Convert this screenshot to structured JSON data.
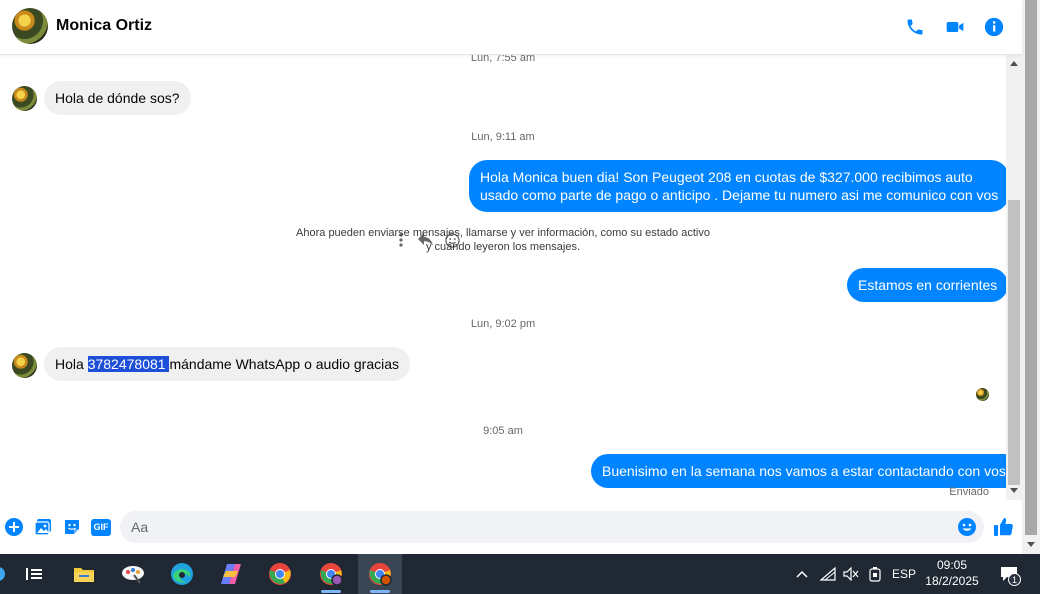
{
  "header": {
    "contact_name": "Monica Ortiz",
    "icons": [
      "phone-icon",
      "video-icon",
      "info-icon"
    ],
    "accent_color": "#0084ff"
  },
  "conversation": {
    "ts1": "Lun, 7:55 am",
    "msg1": "Hola de dónde sos?",
    "ts2": "Lun, 9:11 am",
    "msg2_line1": "Hola Monica buen dia! Son Peugeot 208 en cuotas de $327.000 recibimos auto",
    "msg2_line2": "usado como parte de pago o anticipo . Dejame tu numero asi me comunico con vos",
    "notice_line1": "Ahora pueden enviarse mensajes, llamarse y ver información, como su estado activo",
    "notice_line2": "y cuándo leyeron los mensajes.",
    "msg3": "Estamos en corrientes",
    "ts3": "Lun, 9:02 pm",
    "msg4_before": "Hola ",
    "msg4_selected": "3782478081 ",
    "msg4_after": "mándame WhatsApp o audio gracias",
    "ts4": "9:05 am",
    "msg5": "Buenisimo en la semana nos vamos a estar contactando con vos!",
    "status": "Enviado"
  },
  "composer": {
    "placeholder": "Aa",
    "gif_label": "GIF"
  },
  "taskbar": {
    "lang": "ESP",
    "time": "09:05",
    "date": "18/2/2025",
    "notification_count": "1"
  }
}
